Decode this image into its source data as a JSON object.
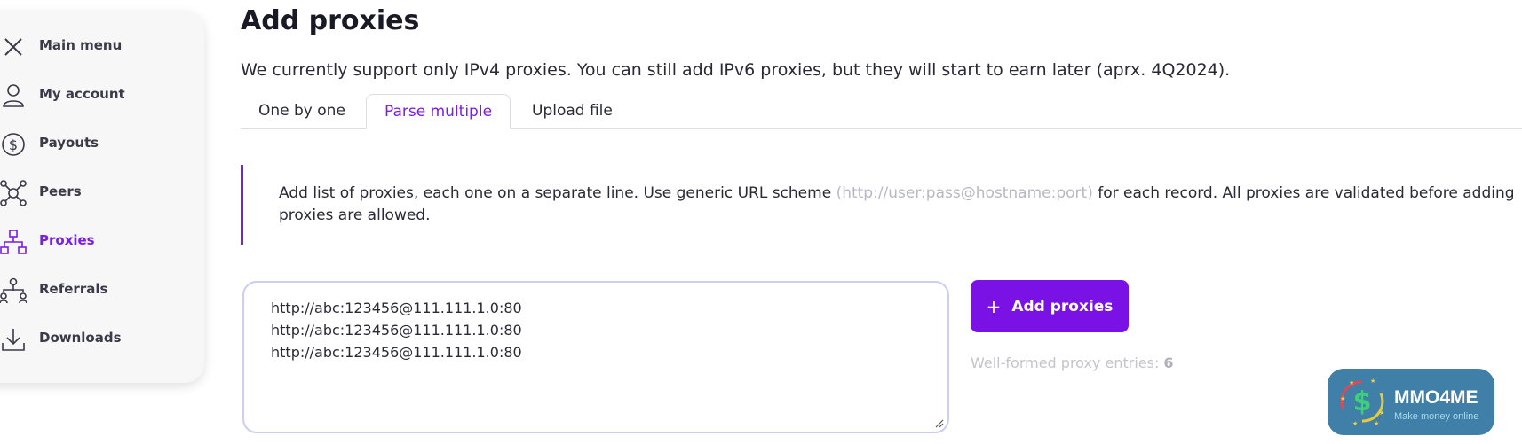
{
  "sidebar": {
    "items": [
      {
        "label": "Main menu",
        "icon": "close-icon"
      },
      {
        "label": "My account",
        "icon": "user-icon"
      },
      {
        "label": "Payouts",
        "icon": "dollar-icon"
      },
      {
        "label": "Peers",
        "icon": "peers-icon"
      },
      {
        "label": "Proxies",
        "icon": "proxies-icon",
        "active": true
      },
      {
        "label": "Referrals",
        "icon": "referrals-icon"
      },
      {
        "label": "Downloads",
        "icon": "download-icon"
      }
    ]
  },
  "main": {
    "title": "Add proxies",
    "subtitle": "We currently support only IPv4 proxies. You can still add IPv6 proxies, but they will start to earn later (aprx. 4Q2024).",
    "tabs": [
      {
        "label": "One by one"
      },
      {
        "label": "Parse multiple",
        "active": true
      },
      {
        "label": "Upload file"
      }
    ],
    "info": {
      "before": "Add list of proxies, each one on a separate line. Use generic URL scheme ",
      "scheme": "(http://user:pass@hostname:port)",
      "after": " for each record. All proxies are validated before adding",
      "line2": "proxies are allowed."
    },
    "proxy_lines": [
      "http://abc:123456@111.111.1.0:80",
      "http://abc:123456@111.111.1.0:80",
      "http://abc:123456@111.111.1.0:80"
    ],
    "add_button_label": "Add proxies",
    "count_label": "Well-formed proxy entries: ",
    "count_value": "6"
  },
  "watermark": {
    "name": "MMO4ME",
    "tagline": "Make money online"
  },
  "colors": {
    "accent": "#7a12e6",
    "active_nav": "#7a1ee0",
    "logo_bg": "#3f7fa8"
  }
}
